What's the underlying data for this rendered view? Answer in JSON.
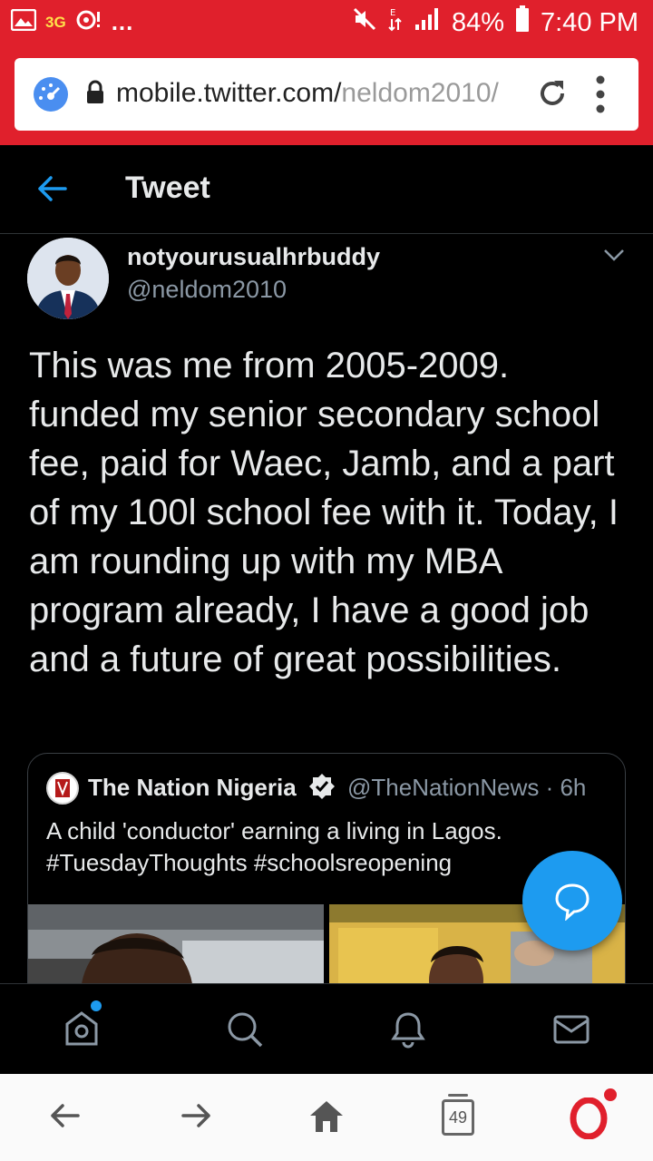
{
  "status_bar": {
    "network": "3G",
    "more": "...",
    "battery": "84%",
    "time": "7:40 PM"
  },
  "address_bar": {
    "domain": "mobile.twitter.com/",
    "path": "neldom2010/"
  },
  "header": {
    "title": "Tweet"
  },
  "tweet": {
    "display_name": "notyourusualhrbuddy",
    "handle": "@neldom2010",
    "text": "This was me from 2005-2009. funded my senior secondary school fee, paid for Waec, Jamb, and a part of my 100l school fee with it. Today, I am rounding up with my MBA program already, I have a good job and a future of great possibilities."
  },
  "quote": {
    "name": "The Nation Nigeria",
    "meta": "@TheNationNews · 6h",
    "line1": "A child 'conductor' earning a living in Lagos.",
    "line2": "#TuesdayThoughts #schoolsreopening"
  },
  "browser": {
    "tab_count": "49"
  },
  "colors": {
    "status_red": "#e0202c",
    "twitter_blue": "#1d9bf0",
    "text": "#e7e9ea",
    "muted": "#8b98a5"
  }
}
